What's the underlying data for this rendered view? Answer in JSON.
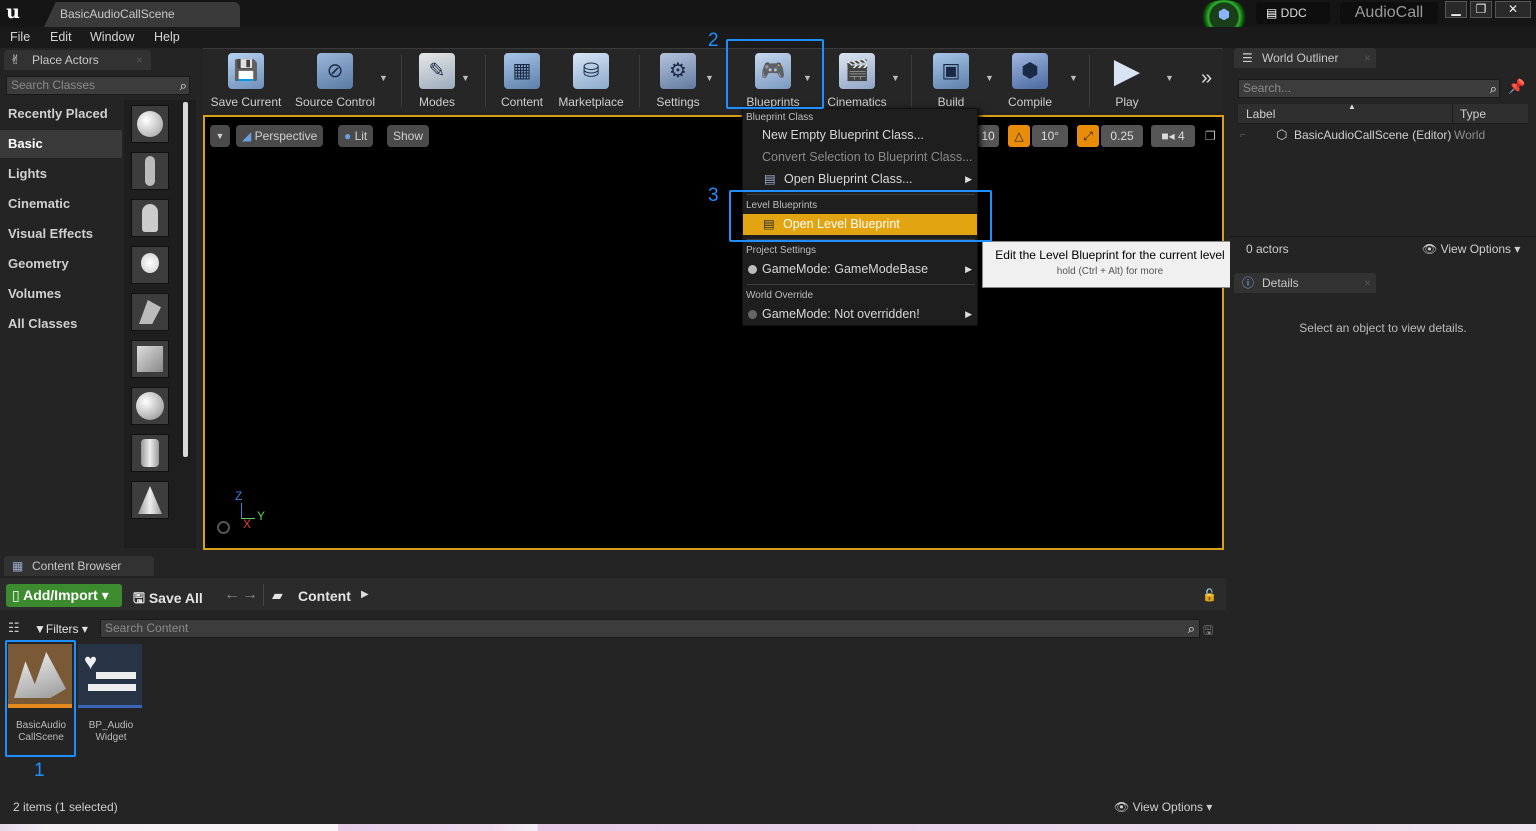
{
  "window": {
    "doc_tab": "BasicAudioCallScene",
    "ddc": "DDC",
    "project": "AudioCall",
    "minimize": "▁",
    "restore": "❐",
    "close": "✕"
  },
  "menus": [
    "File",
    "Edit",
    "Window",
    "Help"
  ],
  "place_actors": {
    "tab": "Place Actors",
    "search_placeholder": "Search Classes",
    "categories": [
      "Recently Placed",
      "Basic",
      "Lights",
      "Cinematic",
      "Visual Effects",
      "Geometry",
      "Volumes",
      "All Classes"
    ]
  },
  "toolbar": {
    "save_current": "Save Current",
    "source_control": "Source Control",
    "modes": "Modes",
    "content": "Content",
    "marketplace": "Marketplace",
    "settings": "Settings",
    "blueprints": "Blueprints",
    "cinematics": "Cinematics",
    "build": "Build",
    "compile": "Compile",
    "play": "Play",
    "more": "»"
  },
  "viewport": {
    "perspective": "Perspective",
    "lit": "Lit",
    "show": "Show",
    "grid_snap": "10",
    "rotation_snap": "10°",
    "scale_snap": "0.25",
    "camera_speed": "4",
    "axis_z": "Z",
    "axis_y": "Y",
    "axis_x": "X"
  },
  "blueprint_menu": {
    "section_class": "Blueprint Class",
    "new_empty": "New Empty Blueprint Class...",
    "convert_selection": "Convert Selection to Blueprint Class...",
    "open_class": "Open Blueprint Class...",
    "section_level": "Level Blueprints",
    "open_level": "Open Level Blueprint",
    "section_project": "Project Settings",
    "gamemode_base": "GameMode: GameModeBase",
    "section_world": "World Override",
    "gamemode_override": "GameMode: Not overridden!"
  },
  "tooltip": {
    "title": "Edit the Level Blueprint for the current level",
    "hint": "hold (Ctrl + Alt) for more"
  },
  "annotations": {
    "n1": "1",
    "n2": "2",
    "n3": "3"
  },
  "world_outliner": {
    "tab": "World Outliner",
    "search_placeholder": "Search...",
    "col_label": "Label",
    "col_type": "Type",
    "row_label": "BasicAudioCallScene (Editor)",
    "row_type": "World",
    "actors": "0 actors",
    "view_options": "View Options"
  },
  "details": {
    "tab": "Details",
    "empty": "Select an object to view details."
  },
  "content_browser": {
    "tab": "Content Browser",
    "add_import": "Add/Import",
    "save_all": "Save All",
    "path": "Content",
    "filters": "Filters",
    "search_placeholder": "Search Content",
    "assets": [
      {
        "line1": "BasicAudio",
        "line2": "CallScene"
      },
      {
        "line1": "BP_Audio",
        "line2": "Widget"
      }
    ],
    "status": "2 items (1 selected)",
    "view_options": "View Options"
  }
}
